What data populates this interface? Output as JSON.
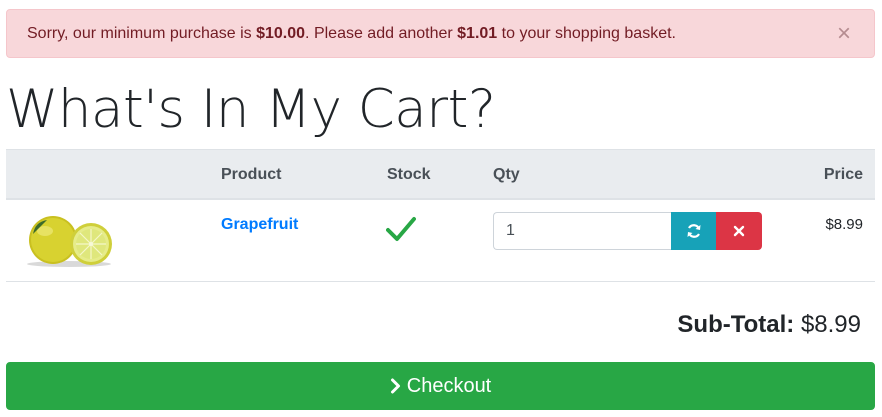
{
  "alert": {
    "prefix": "Sorry, our minimum purchase is ",
    "minimum": "$10.00",
    "middle": ". Please add another ",
    "remaining": "$1.01",
    "suffix": " to your shopping basket.",
    "close_label": "×"
  },
  "page_title": "What's In My Cart?",
  "table": {
    "headers": {
      "product": "Product",
      "stock": "Stock",
      "qty": "Qty",
      "price": "Price"
    },
    "rows": [
      {
        "product": "Grapefruit",
        "in_stock": true,
        "qty": "1",
        "price": "$8.99"
      }
    ]
  },
  "subtotal": {
    "label": "Sub-Total:",
    "amount": "$8.99"
  },
  "checkout": {
    "label": "Checkout"
  },
  "colors": {
    "alert_bg": "#f8d7da",
    "link": "#007bff",
    "stock_check": "#28a745",
    "refresh": "#17a2b8",
    "remove": "#dc3545",
    "checkout": "#28a745"
  },
  "icons": {
    "alert_close": "close-icon",
    "stock": "checkmark-icon",
    "refresh": "refresh-icon",
    "remove": "times-icon",
    "checkout": "chevron-right-icon"
  }
}
